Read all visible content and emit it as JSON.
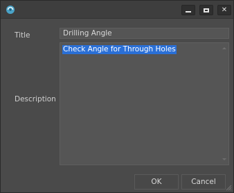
{
  "window": {
    "icon": "app-logo-icon",
    "controls": {
      "minimize": "minimize-icon",
      "maximize": "maximize-icon",
      "close": "✕"
    }
  },
  "form": {
    "title_label": "Title",
    "title_value": "Drilling Angle",
    "description_label": "Description",
    "description_value": "Check Angle for Through Holes"
  },
  "buttons": {
    "ok": "OK",
    "cancel": "Cancel"
  },
  "colors": {
    "accent": "#2a6fd6",
    "background": "#4a4a4a",
    "field": "#555555"
  }
}
